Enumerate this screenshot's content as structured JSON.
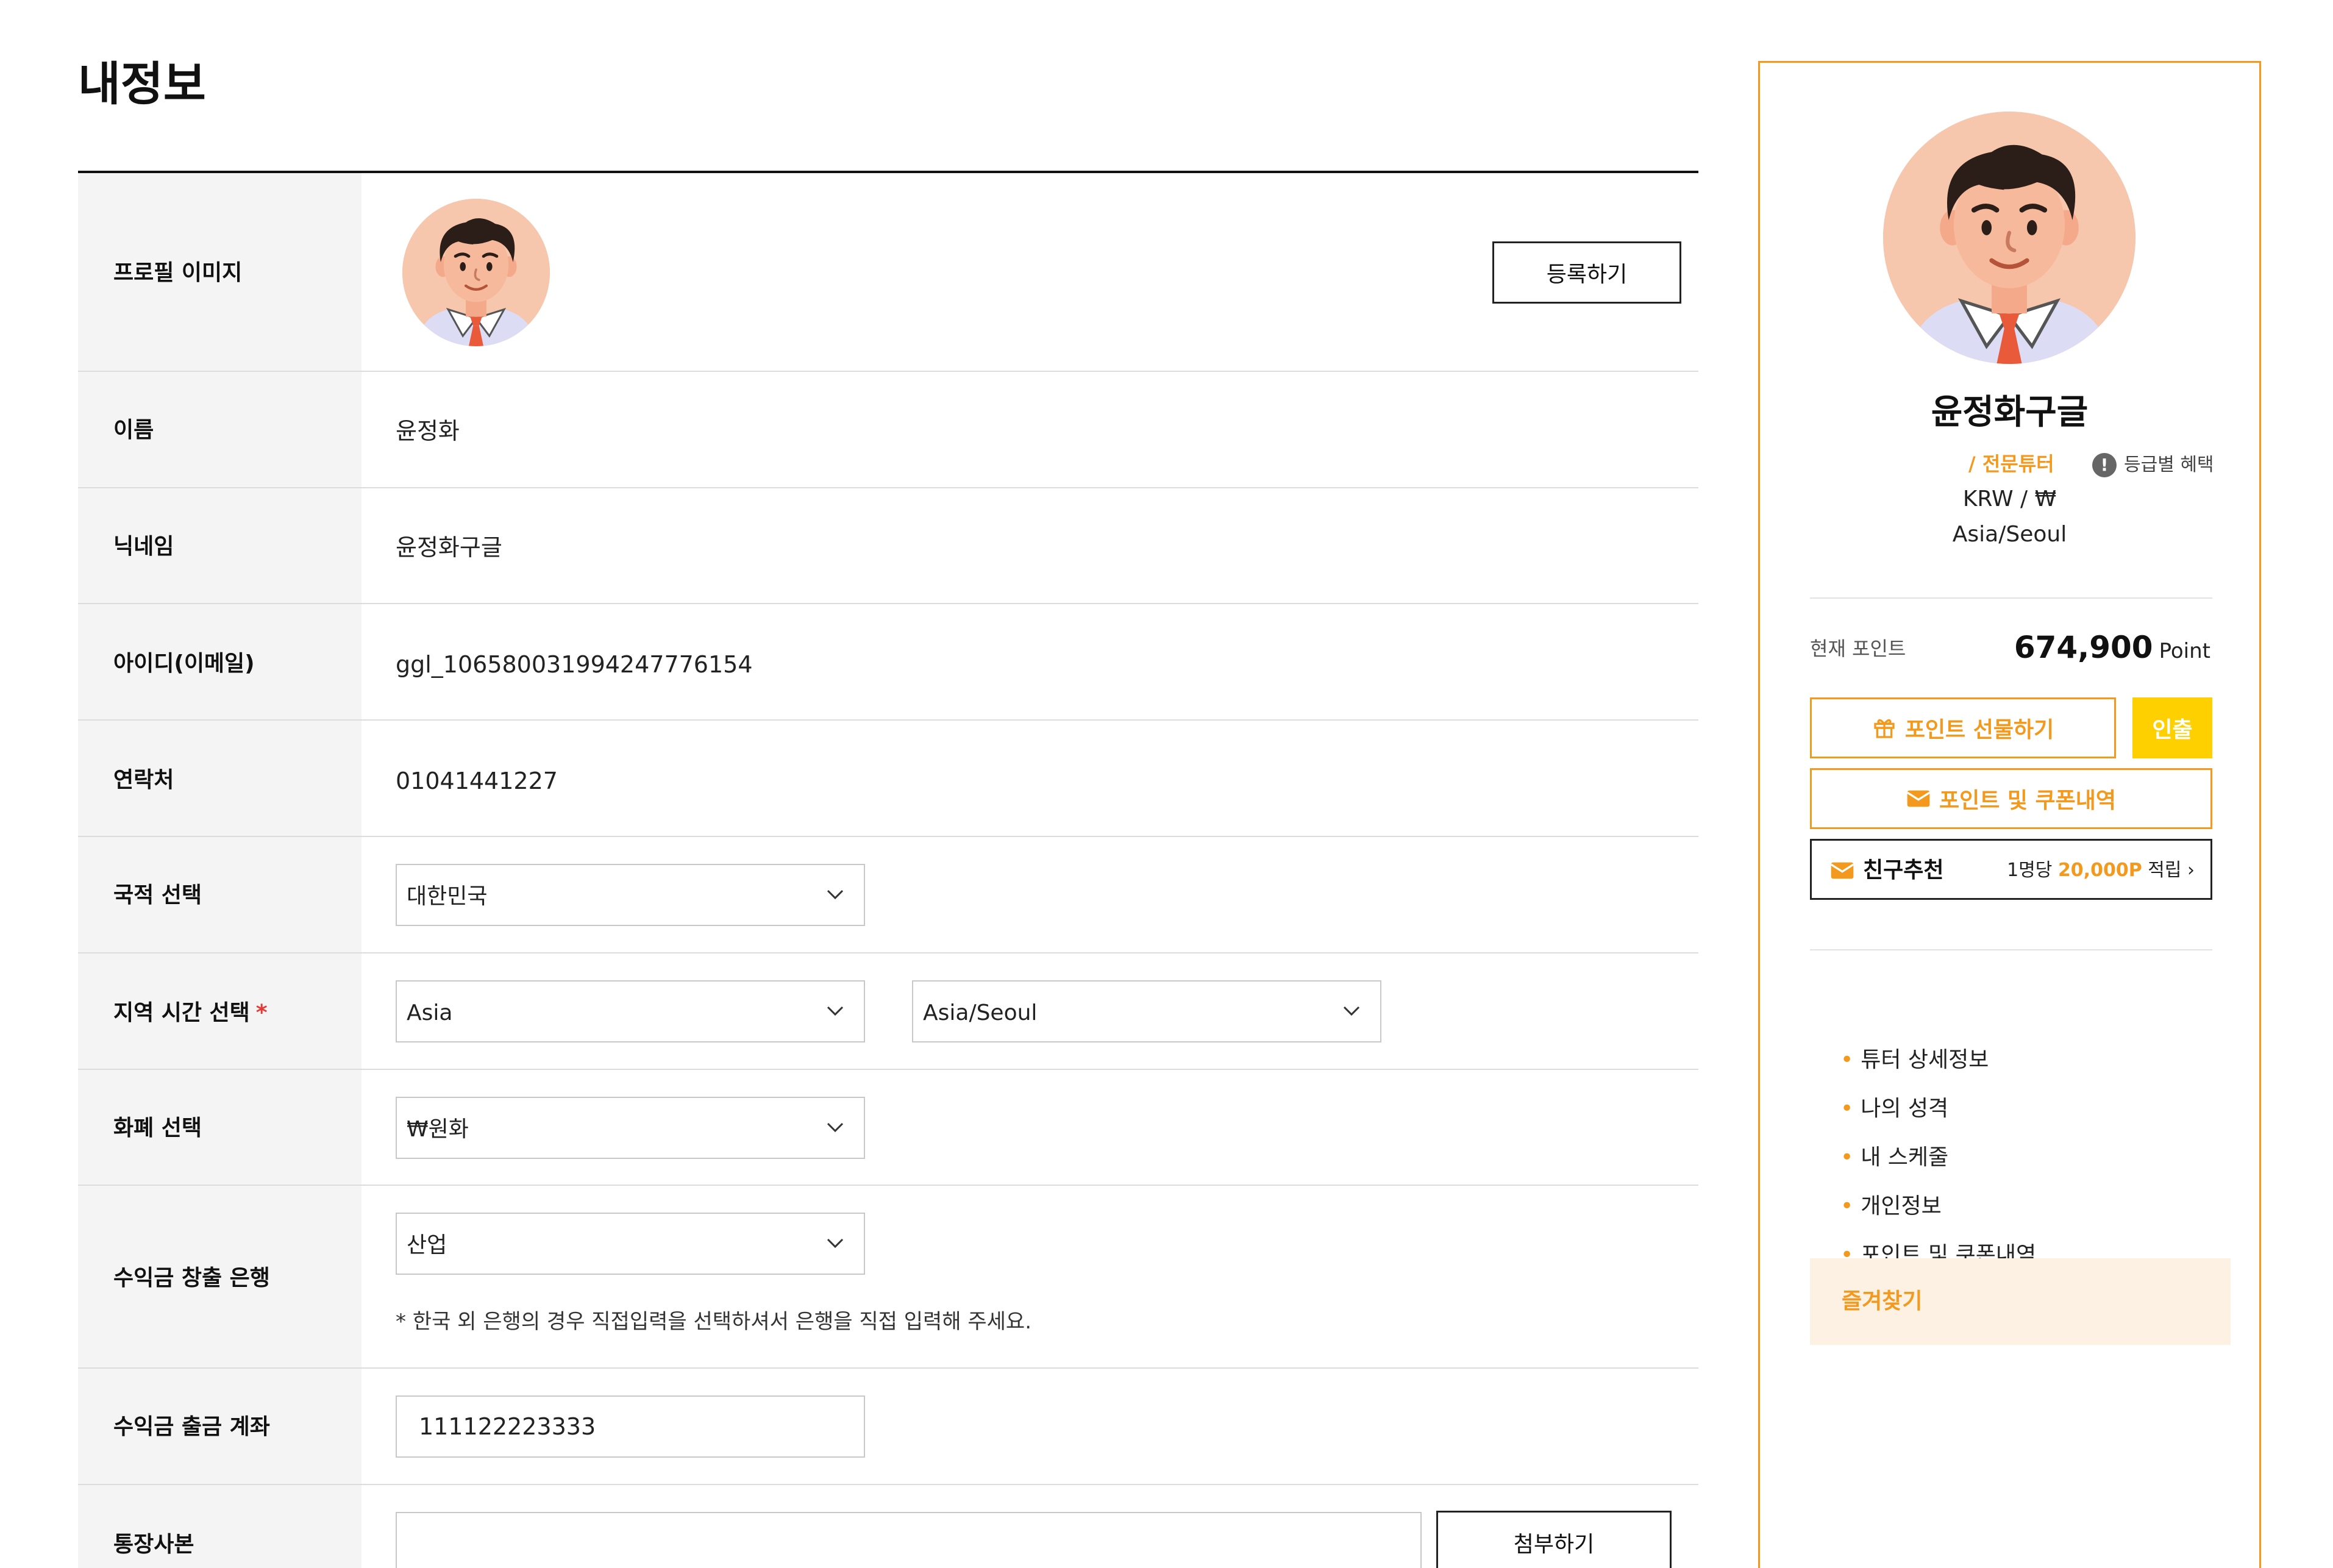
{
  "page": {
    "title": "내정보"
  },
  "form": {
    "profile_image": {
      "label": "프로필 이미지",
      "button_label": "등록하기"
    },
    "name": {
      "label": "이름",
      "value": "윤정화"
    },
    "nickname": {
      "label": "닉네임",
      "value": "윤정화구글"
    },
    "user_id": {
      "label": "아이디(이메일)",
      "value": "ggl_106580031994247776154"
    },
    "contact": {
      "label": "연락처",
      "value": "01041441227"
    },
    "nationality": {
      "label": "국적 선택",
      "selected": "대한민국"
    },
    "timezone": {
      "label": "지역 시간 선택",
      "required_mark": "*",
      "region_selected": "Asia",
      "zone_selected": "Asia/Seoul"
    },
    "currency": {
      "label": "화폐 선택",
      "selected": "₩원화"
    },
    "bank": {
      "label": "수익금 창출 은행",
      "selected": "산업",
      "note": "* 한국 외 은행의 경우 직접입력을 선택하셔서 은행을 직접 입력해 주세요."
    },
    "account": {
      "label": "수익금 출금 계좌",
      "value": "111122223333"
    },
    "bankbook": {
      "label": "통장사본",
      "value": "",
      "button_label": "첨부하기"
    }
  },
  "sidebar": {
    "name": "윤정화구글",
    "level": "/ 전문튜터",
    "benefit_label": "등급별 혜택",
    "benefit_icon": "info-icon",
    "currency": "KRW / ₩",
    "timezone": "Asia/Seoul",
    "point_label": "현재 포인트",
    "point_value": "674,900",
    "point_unit": "Point",
    "gift_button": "포인트 선물하기",
    "gift_icon": "gift-icon",
    "withdraw_button": "인출",
    "coupon_button": "포인트 및 쿠폰내역",
    "coupon_icon": "mail-icon",
    "referral": {
      "label": "친구추천",
      "icon": "mail-icon",
      "prefix": "1명당",
      "amount": "20,000P",
      "suffix": "적립"
    },
    "menu": [
      {
        "label": "튜터 상세정보"
      },
      {
        "label": "나의 성격"
      },
      {
        "label": "내 스케줄"
      },
      {
        "label": "개인정보"
      },
      {
        "label": "포인트 및 쿠폰내역"
      }
    ],
    "favorites_label": "즐겨찾기"
  },
  "colors": {
    "accent": "#f39a1e",
    "withdraw": "#ffd000",
    "favorites_bg": "#fdf1e3",
    "required": "#e53935",
    "label_bg": "#f4f4f4"
  }
}
